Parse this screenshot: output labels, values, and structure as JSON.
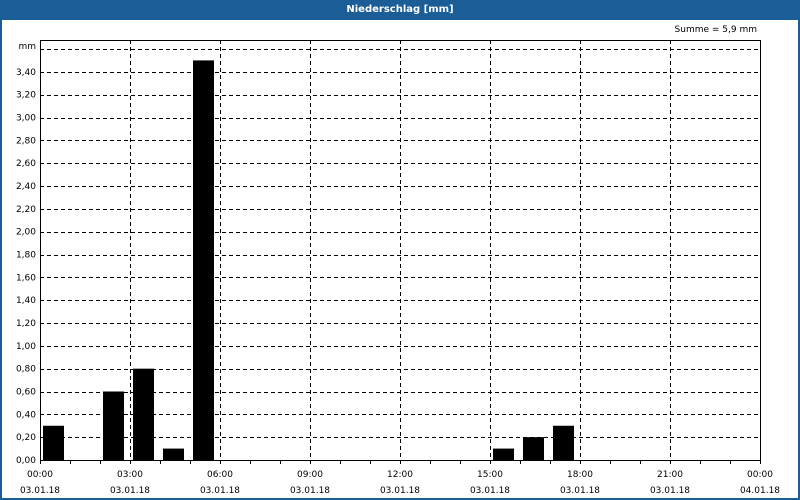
{
  "window": {
    "title": "Niederschlag [mm]"
  },
  "summary": "Summe = 5,9 mm",
  "chart_data": {
    "type": "bar",
    "title": "Niederschlag [mm]",
    "ylabel": "mm",
    "xlabel": "",
    "ylim": [
      0,
      3.6
    ],
    "y_ticks": [
      "0,00",
      "0,20",
      "0,40",
      "0,60",
      "0,80",
      "1,00",
      "1,20",
      "1,40",
      "1,60",
      "1,80",
      "2,00",
      "2,20",
      "2,40",
      "2,60",
      "2,80",
      "3,00",
      "3,20",
      "3,40"
    ],
    "x_range_hours": [
      0,
      24
    ],
    "x_ticks": [
      {
        "time": "00:00",
        "date": "03.01.18"
      },
      {
        "time": "03:00",
        "date": "03.01.18"
      },
      {
        "time": "06:00",
        "date": "03.01.18"
      },
      {
        "time": "09:00",
        "date": "03.01.18"
      },
      {
        "time": "12:00",
        "date": "03.01.18"
      },
      {
        "time": "15:00",
        "date": "03.01.18"
      },
      {
        "time": "18:00",
        "date": "03.01.18"
      },
      {
        "time": "21:00",
        "date": "03.01.18"
      },
      {
        "time": "00:00",
        "date": "04.01.18"
      }
    ],
    "bars": [
      {
        "hour": 0,
        "value": 0.3
      },
      {
        "hour": 2,
        "value": 0.6
      },
      {
        "hour": 3,
        "value": 0.8
      },
      {
        "hour": 4,
        "value": 0.1
      },
      {
        "hour": 5,
        "value": 3.5
      },
      {
        "hour": 15,
        "value": 0.1
      },
      {
        "hour": 16,
        "value": 0.2
      },
      {
        "hour": 17,
        "value": 0.3
      }
    ],
    "grid": true,
    "bar_color": "#000000"
  }
}
